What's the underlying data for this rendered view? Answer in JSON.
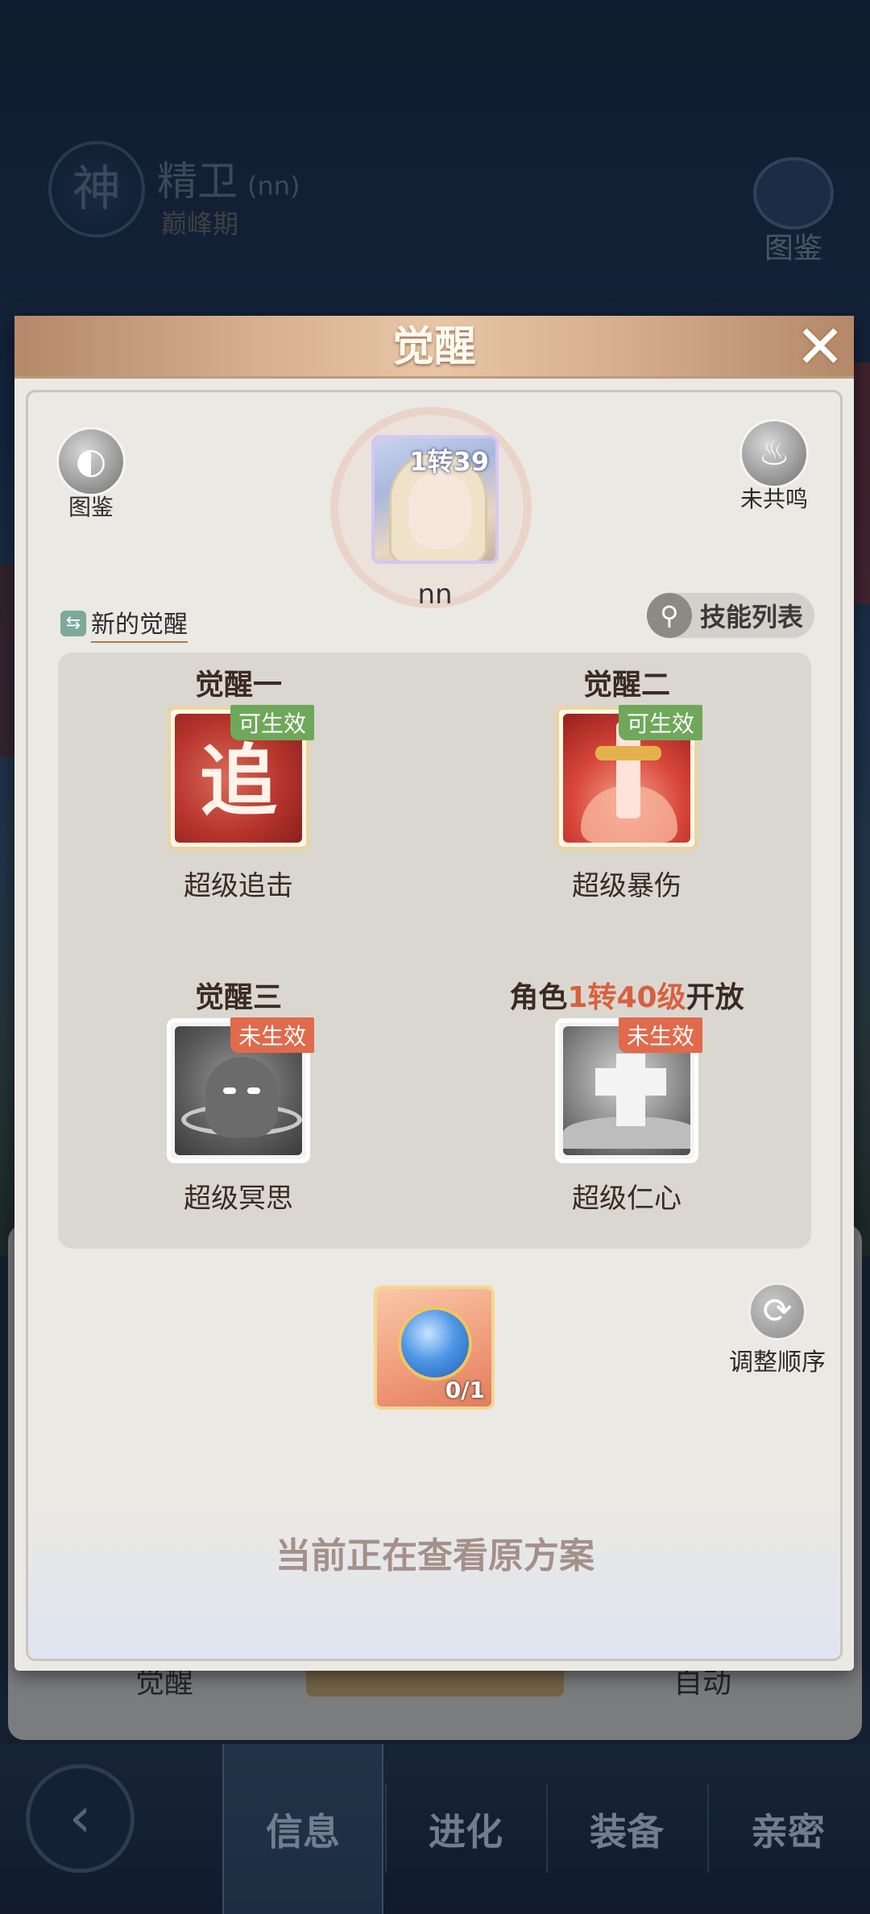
{
  "background": {
    "god_emblem": "神",
    "hero_name": "精卫",
    "hero_tag": "(nn)",
    "hero_stage": "巅峰期",
    "codex_label": "图鉴",
    "bottom_left_label": "觉醒",
    "bottom_right_label": "自动"
  },
  "tabbar": {
    "back_icon": "back-arrow-icon",
    "tabs": [
      {
        "label": "信息",
        "active": true
      },
      {
        "label": "进化",
        "active": false
      },
      {
        "label": "装备",
        "active": false
      },
      {
        "label": "亲密",
        "active": false
      }
    ]
  },
  "dialog": {
    "title": "觉醒",
    "close_glyph": "✕",
    "codex_button": {
      "label": "图鉴",
      "icon": "book-icon"
    },
    "resonance_button": {
      "label": "未共鸣",
      "icon": "flame-orb-icon"
    },
    "hero": {
      "level_badge": "1转39",
      "name": "nn"
    },
    "new_awakening_link": "新的觉醒",
    "skill_list_button": "技能列表",
    "awakenings": [
      {
        "title": "觉醒一",
        "title_prefix": "",
        "title_highlight": "",
        "title_suffix": "",
        "badge": "可生效",
        "active": true,
        "name": "超级追击",
        "glyph": "追"
      },
      {
        "title": "觉醒二",
        "title_prefix": "",
        "title_highlight": "",
        "title_suffix": "",
        "badge": "可生效",
        "active": true,
        "name": "超级暴伤",
        "glyph": ""
      },
      {
        "title": "觉醒三",
        "title_prefix": "",
        "title_highlight": "",
        "title_suffix": "",
        "badge": "未生效",
        "active": false,
        "name": "超级冥思",
        "glyph": ""
      },
      {
        "title": "",
        "title_prefix": "角色",
        "title_highlight": "1转40级",
        "title_suffix": "开放",
        "badge": "未生效",
        "active": false,
        "name": "超级仁心",
        "glyph": ""
      }
    ],
    "consumable": {
      "count": "0/1",
      "icon": "blue-orb-icon"
    },
    "reorder_button": "调整顺序",
    "viewing_note": "当前正在查看原方案"
  },
  "colors": {
    "active_badge": "#6fa85a",
    "inactive_badge": "#e06a4c",
    "highlight_text": "#d9603e",
    "title_bar": "#d8b092"
  }
}
